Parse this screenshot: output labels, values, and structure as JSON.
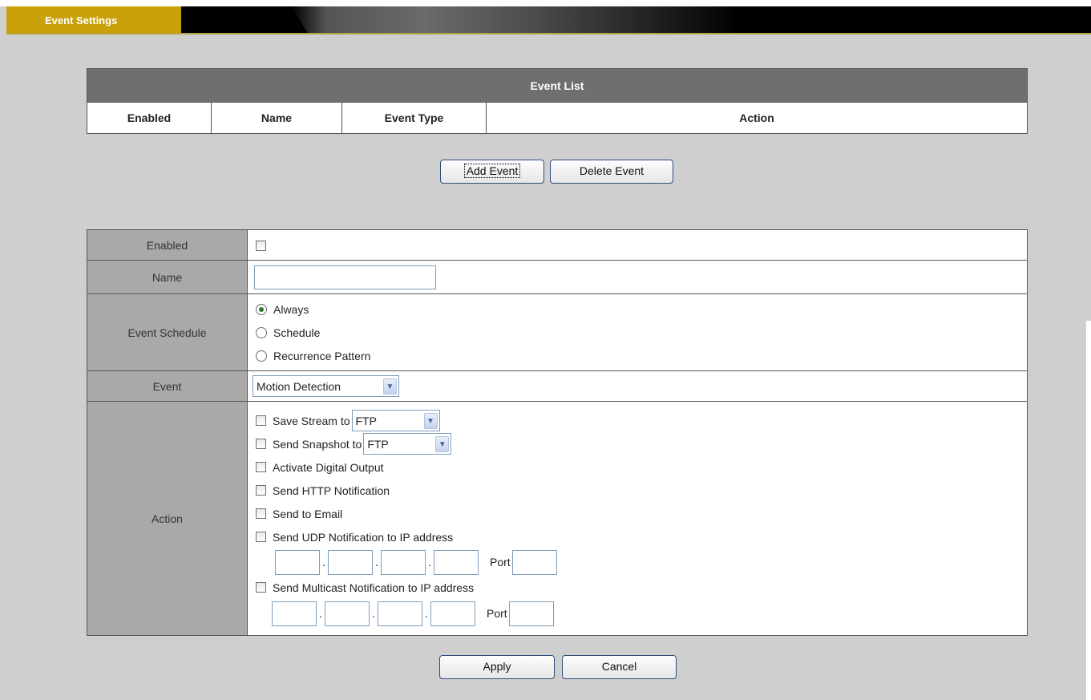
{
  "header": {
    "tab_label": "Event Settings"
  },
  "event_list": {
    "title": "Event List",
    "columns": [
      "Enabled",
      "Name",
      "Event Type",
      "Action"
    ]
  },
  "list_buttons": {
    "add": "Add Event",
    "delete": "Delete Event"
  },
  "form": {
    "enabled_label": "Enabled",
    "enabled_checked": false,
    "name_label": "Name",
    "name_value": "",
    "schedule_label": "Event Schedule",
    "schedule_options": [
      "Always",
      "Schedule",
      "Recurrence Pattern"
    ],
    "schedule_selected": "Always",
    "event_label": "Event",
    "event_value": "Motion Detection",
    "action_label": "Action",
    "actions": {
      "save_stream": "Save Stream to",
      "save_stream_target": "FTP",
      "send_snapshot": "Send Snapshot to",
      "send_snapshot_target": "FTP",
      "digital_output": "Activate Digital Output",
      "http_notification": "Send HTTP Notification",
      "email": "Send to Email",
      "udp_notification": "Send UDP Notification to IP address",
      "multicast_notification": "Send Multicast Notification to IP address",
      "port_label": "Port",
      "ip_separator": "."
    }
  },
  "footer_buttons": {
    "apply": "Apply",
    "cancel": "Cancel"
  }
}
